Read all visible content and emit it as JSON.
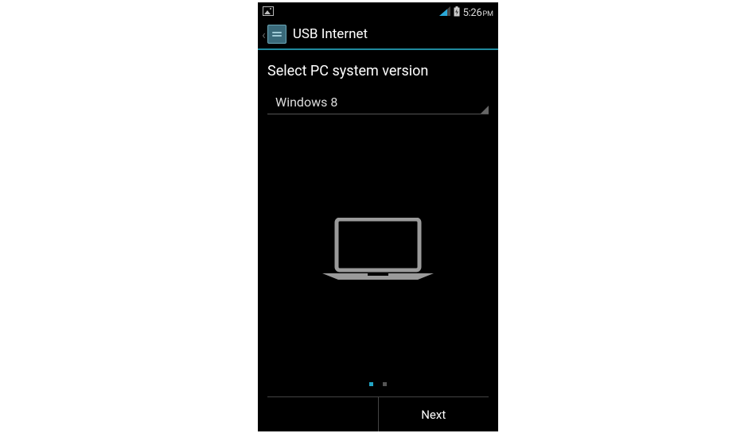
{
  "status_bar": {
    "time": "5:26",
    "ampm": "PM"
  },
  "action_bar": {
    "title": "USB Internet"
  },
  "main": {
    "heading": "Select PC system version",
    "spinner_value": "Windows 8"
  },
  "pager": {
    "active_index": 0,
    "count": 2
  },
  "footer": {
    "next_label": "Next"
  }
}
